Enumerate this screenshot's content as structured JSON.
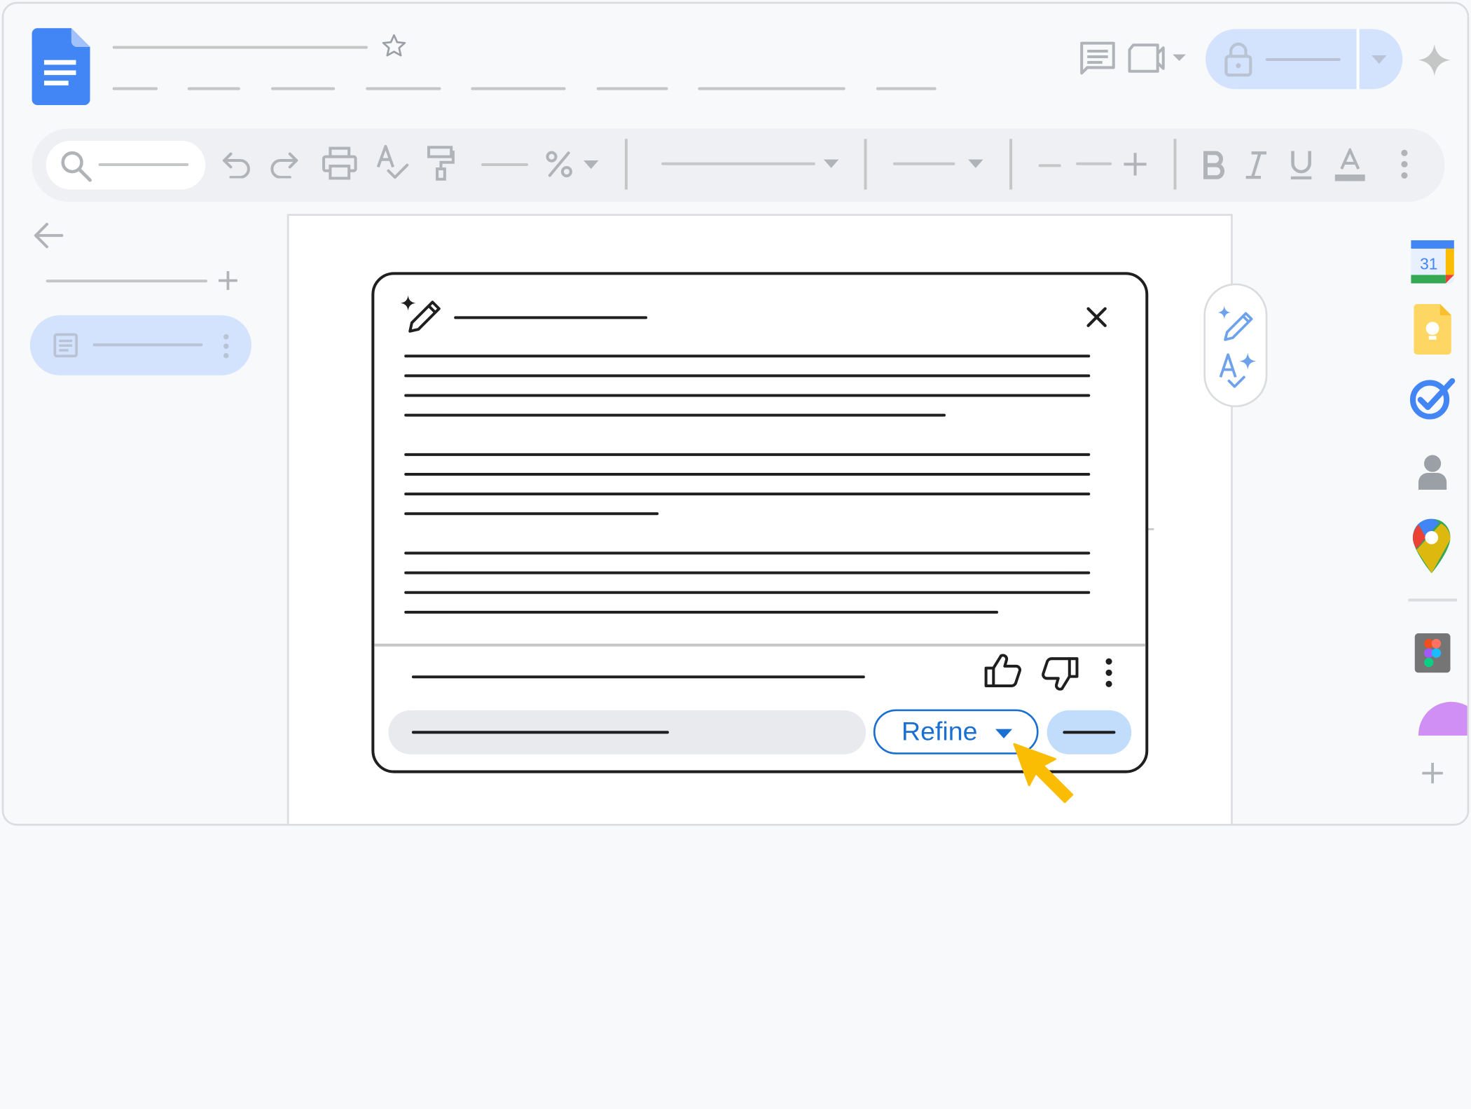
{
  "refine_dialog": {
    "refine_label": "Refine"
  },
  "calendar": {
    "day": "31"
  },
  "colors": {
    "docs_blue": "#4285f4",
    "accent_blue": "#1a6fd0",
    "share_pill": "#d3e3fd",
    "cursor_yellow": "#fbbc04",
    "keep_yellow": "#fdd663"
  },
  "icons": [
    "docs-logo-icon",
    "star-icon",
    "comment-icon",
    "video-icon",
    "lock-icon",
    "gemini-sparkle-icon",
    "search-icon",
    "undo-icon",
    "redo-icon",
    "print-icon",
    "spellcheck-icon",
    "paint-format-icon",
    "bold-icon",
    "italic-icon",
    "underline-icon",
    "text-color-icon",
    "more-vert-icon",
    "back-arrow-icon",
    "add-icon",
    "document-icon",
    "help-me-write-icon",
    "close-icon",
    "thumbs-up-icon",
    "thumbs-down-icon",
    "refine-caret-icon",
    "cursor-arrow-icon",
    "calendar-icon",
    "keep-icon",
    "tasks-icon",
    "contacts-icon",
    "maps-icon",
    "figma-icon"
  ]
}
